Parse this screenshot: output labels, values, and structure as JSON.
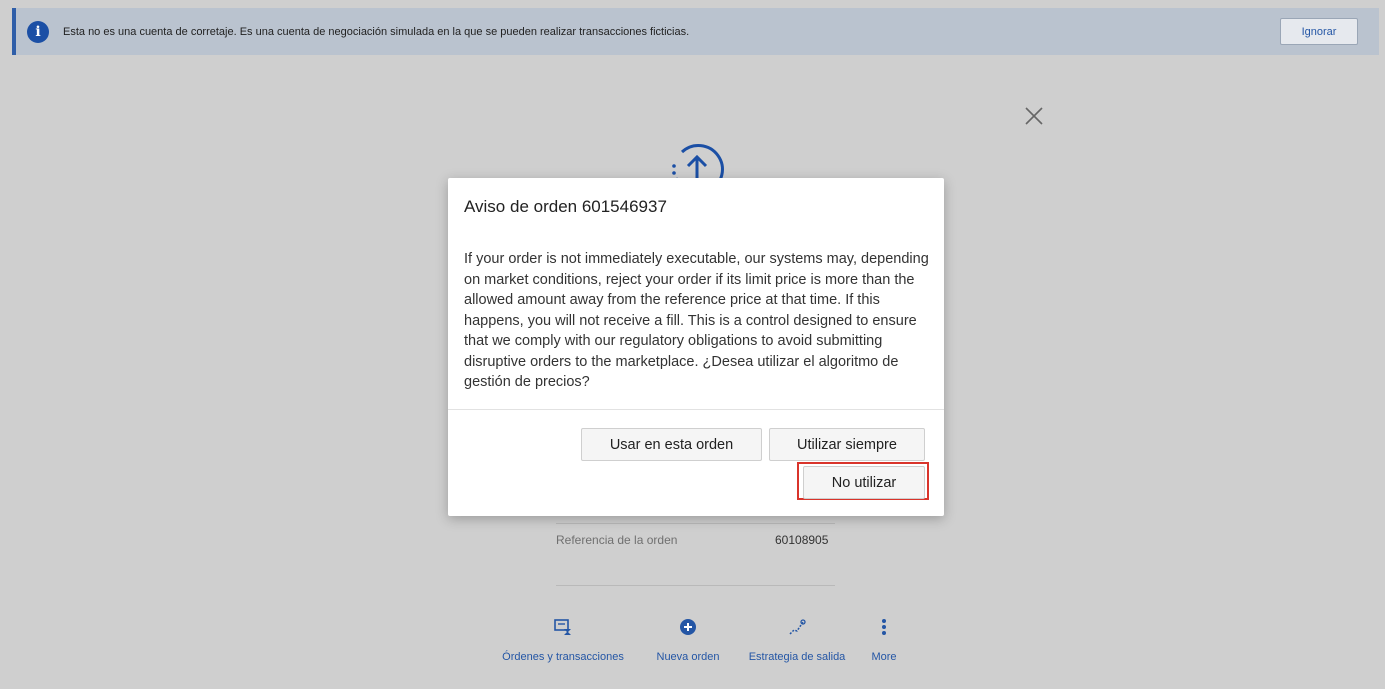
{
  "banner": {
    "message": "Esta no es una cuenta de corretaje. Es una cuenta de negociación simulada en la que se pueden realizar transacciones ficticias.",
    "ignore_label": "Ignorar",
    "icon": "info-icon"
  },
  "background": {
    "order_reference_label": "Referencia de la orden",
    "order_reference_value": "60108905",
    "actions": [
      {
        "label": "Órdenes y transacciones",
        "icon": "orders-icon"
      },
      {
        "label": "Nueva orden",
        "icon": "plus-circle-icon"
      },
      {
        "label": "Estrategia de salida",
        "icon": "exit-strategy-icon"
      },
      {
        "label": "More",
        "icon": "more-vertical-icon"
      }
    ]
  },
  "modal": {
    "title": "Aviso de orden 601546937",
    "body": "If your order is not immediately executable, our systems may, depending on market conditions, reject your order if its limit price is more than the allowed amount away from the reference price at that time. If this happens, you will not receive a fill. This is a control designed to ensure that we comply with our regulatory obligations to avoid submitting disruptive orders to the marketplace. ¿Desea utilizar el algoritmo de gestión de precios?",
    "buttons": {
      "use_this_order": "Usar en esta orden",
      "always_use": "Utilizar siempre",
      "do_not_use": "No utilizar"
    }
  },
  "colors": {
    "accent": "#2456a5",
    "highlight": "#d9342b",
    "overlay": "#cfcfcf"
  }
}
